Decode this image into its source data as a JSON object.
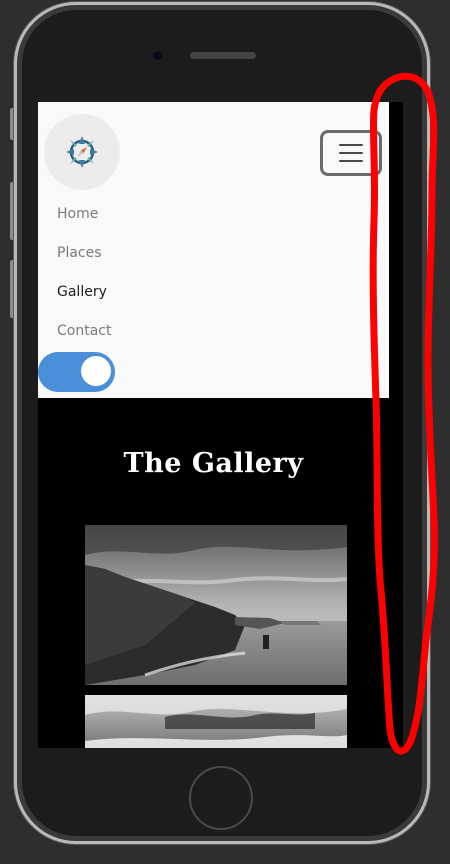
{
  "nav": {
    "items": [
      {
        "label": "Home",
        "active": false
      },
      {
        "label": "Places",
        "active": false
      },
      {
        "label": "Gallery",
        "active": true
      },
      {
        "label": "Contact",
        "active": false
      }
    ],
    "theme_toggle_on": true
  },
  "page": {
    "title": "The Gallery"
  },
  "icons": {
    "logo": "compass-icon",
    "menu": "hamburger-menu-icon"
  },
  "gallery": {
    "images": [
      "cliffs-photo",
      "sea-clouds-photo"
    ]
  },
  "colors": {
    "navbar_bg": "#f8f9fa",
    "toggle_accent": "#4a8fd7",
    "page_bg": "#000000",
    "annotation": "#ff0000"
  }
}
